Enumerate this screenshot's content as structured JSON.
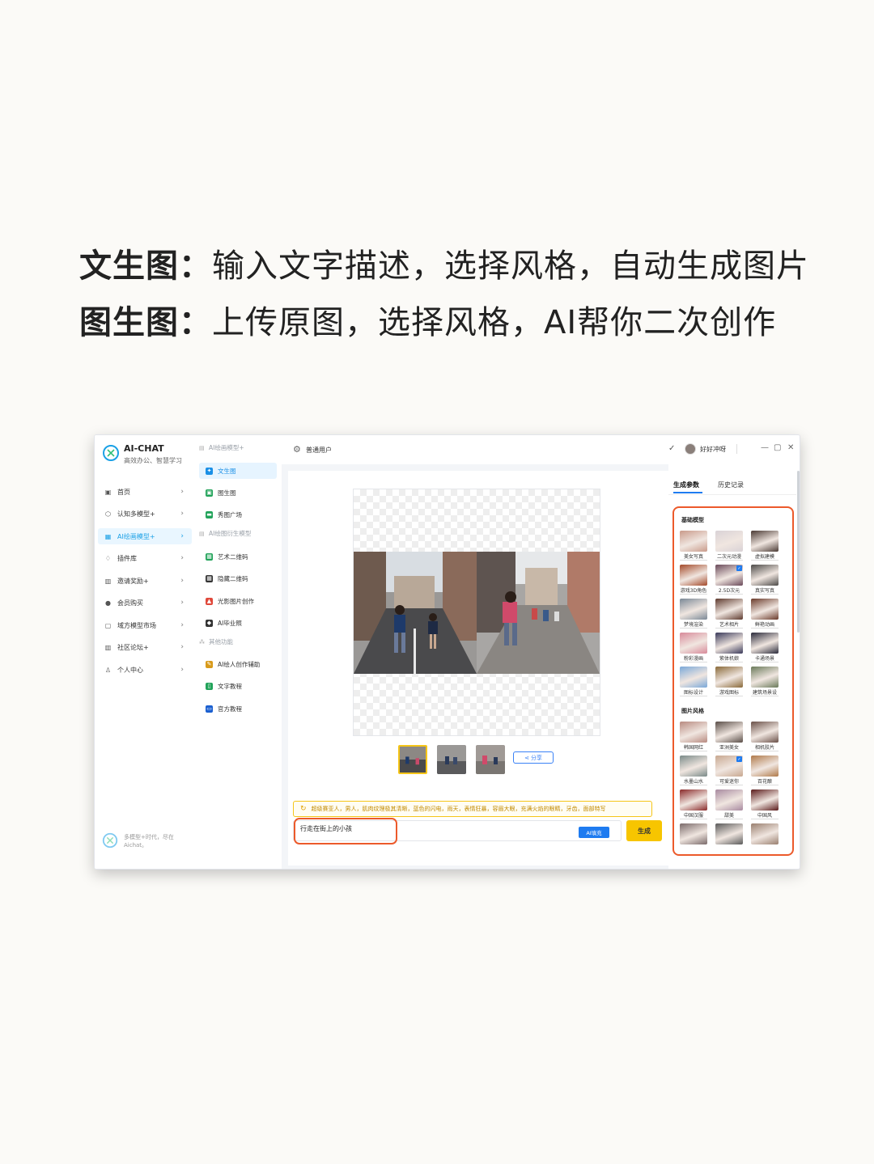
{
  "headline": {
    "line1_bold": "文生图：",
    "line1_rest": "输入文字描述，选择风格，自动生成图片",
    "line2_bold": "图生图：",
    "line2_rest": "上传原图，选择风格，AI帮你二次创作"
  },
  "brand": {
    "title": "AI-CHAT",
    "subtitle": "高效办公、智慧学习"
  },
  "sidebar": {
    "items": [
      {
        "label": "首页",
        "icon": "home-icon"
      },
      {
        "label": "认知多模型+",
        "icon": "cube-icon"
      },
      {
        "label": "AI绘画模型+",
        "icon": "grid-icon",
        "active": true
      },
      {
        "label": "插件库",
        "icon": "diamond-icon"
      },
      {
        "label": "邀请奖励+",
        "icon": "gift-icon"
      },
      {
        "label": "会员购买",
        "icon": "user-icon"
      },
      {
        "label": "域方模型市场",
        "icon": "store-icon"
      },
      {
        "label": "社区论坛+",
        "icon": "forum-icon"
      },
      {
        "label": "个人中心",
        "icon": "person-icon"
      }
    ],
    "footer": "多模型+时代，尽在Aichat。"
  },
  "subnav": {
    "group1": "AI绘画模型+",
    "group1_items": [
      {
        "label": "文生图",
        "active": true,
        "color": "#1a8fe6"
      },
      {
        "label": "图生图",
        "color": "#22a35a"
      },
      {
        "label": "秀图广场",
        "color": "#22a35a"
      }
    ],
    "group2": "AI绘图衍生模型",
    "group2_items": [
      {
        "label": "艺术二维码",
        "color": "#22a35a"
      },
      {
        "label": "隐藏二维码",
        "color": "#333333"
      },
      {
        "label": "光影图片创作",
        "color": "#e0483a"
      },
      {
        "label": "AI毕业照",
        "color": "#333333"
      }
    ],
    "group3": "其他功能",
    "group3_items": [
      {
        "label": "AI绘人创作辅助",
        "color": "#d89a1a"
      },
      {
        "label": "文字教程",
        "color": "#22a35a"
      },
      {
        "label": "官方教程",
        "color": "#1a5fd0"
      }
    ]
  },
  "topbar": {
    "user_type": "普通用户",
    "username": "好好冲呀"
  },
  "share_label": "分享",
  "hint_text": "超级赛亚人，男人，肌肉纹理极其清晰，蓝色的闪电，雨天，表情狂暴，容眉大眼，充满火焰的眼睛，牙齿，面部特写",
  "prompt": {
    "value": "行走在街上的小孩",
    "ai_fill": "AI填充",
    "generate": "生成"
  },
  "right_panel": {
    "tabs": [
      "生成参数",
      "历史记录"
    ],
    "section1": "基础模型",
    "base_models": [
      {
        "label": "美女写真",
        "tone": "#c99a8a"
      },
      {
        "label": "二次元动漫",
        "tone": "#d9d2d6"
      },
      {
        "label": "虚拟建模",
        "tone": "#4a3a34"
      },
      {
        "label": "游戏3D角色",
        "tone": "#a44a2a"
      },
      {
        "label": "2.5D次元",
        "tone": "#6a4a5a",
        "checked": true
      },
      {
        "label": "真实写真",
        "tone": "#4c4a48"
      },
      {
        "label": "梦境渲染",
        "tone": "#7a8896"
      },
      {
        "label": "艺术相片",
        "tone": "#5e3a2e"
      },
      {
        "label": "鲜艳动画",
        "tone": "#6a3a2a"
      },
      {
        "label": "粉彩漫画",
        "tone": "#d88a9a"
      },
      {
        "label": "紫体机娘",
        "tone": "#3a3a5a"
      },
      {
        "label": "卡通场景",
        "tone": "#2a2a3a"
      },
      {
        "label": "图标设计",
        "tone": "#7aa8d8"
      },
      {
        "label": "游戏图标",
        "tone": "#8a6a3a"
      },
      {
        "label": "建筑场景设",
        "tone": "#6a7a5a"
      }
    ],
    "section2": "图片风格",
    "styles": [
      {
        "label": "韩国网红",
        "tone": "#b88a80"
      },
      {
        "label": "亚洲美女",
        "tone": "#5a4e48"
      },
      {
        "label": "相机胶片",
        "tone": "#6a5048"
      },
      {
        "label": "水墨山水",
        "tone": "#7a8a88"
      },
      {
        "label": "可爱迷你",
        "tone": "#c8a890",
        "checked": true
      },
      {
        "label": "百花酿",
        "tone": "#b07a4a"
      },
      {
        "label": "中国汉服",
        "tone": "#8a2a2a"
      },
      {
        "label": "甜美",
        "tone": "#a88aa0"
      },
      {
        "label": "中国风",
        "tone": "#5a1a1a"
      },
      {
        "label": "",
        "tone": "#7a6a6a"
      },
      {
        "label": "",
        "tone": "#5a5a5a"
      },
      {
        "label": "",
        "tone": "#9a8070"
      }
    ]
  }
}
